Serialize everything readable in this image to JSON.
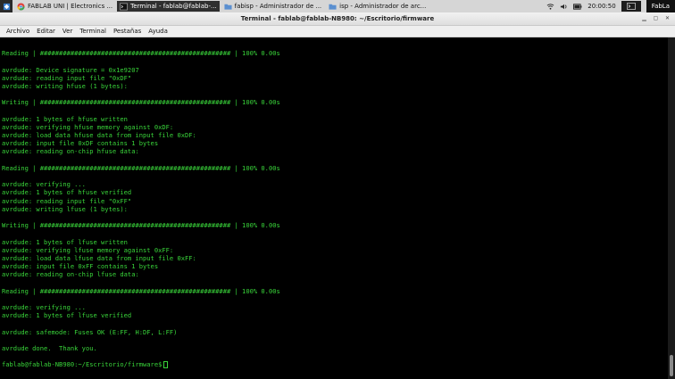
{
  "taskbar": {
    "tasks": [
      {
        "label": "FABLAB UNI | Electronics ...",
        "icon": "chrome-icon"
      },
      {
        "label": "Terminal - fablab@fablab-...",
        "icon": "terminal-icon"
      },
      {
        "label": "fabisp - Administrador de ...",
        "icon": "folder-icon"
      },
      {
        "label": "isp - Administrador de arc...",
        "icon": "folder-icon"
      }
    ],
    "clock": "20:00:50",
    "right_title": "FabLa"
  },
  "window": {
    "title": "Terminal - fablab@fablab-NB980: ~/Escritorio/firmware"
  },
  "menu": {
    "items": [
      "Archivo",
      "Editar",
      "Ver",
      "Terminal",
      "Pestañas",
      "Ayuda"
    ]
  },
  "terminal": {
    "lines": [
      "",
      "Reading | ################################################## | 100% 0.00s",
      "",
      "avrdude: Device signature = 0x1e9207",
      "avrdude: reading input file \"0xDF\"",
      "avrdude: writing hfuse (1 bytes):",
      "",
      "Writing | ################################################## | 100% 0.00s",
      "",
      "avrdude: 1 bytes of hfuse written",
      "avrdude: verifying hfuse memory against 0xDF:",
      "avrdude: load data hfuse data from input file 0xDF:",
      "avrdude: input file 0xDF contains 1 bytes",
      "avrdude: reading on-chip hfuse data:",
      "",
      "Reading | ################################################## | 100% 0.00s",
      "",
      "avrdude: verifying ...",
      "avrdude: 1 bytes of hfuse verified",
      "avrdude: reading input file \"0xFF\"",
      "avrdude: writing lfuse (1 bytes):",
      "",
      "Writing | ################################################## | 100% 0.00s",
      "",
      "avrdude: 1 bytes of lfuse written",
      "avrdude: verifying lfuse memory against 0xFF:",
      "avrdude: load data lfuse data from input file 0xFF:",
      "avrdude: input file 0xFF contains 1 bytes",
      "avrdude: reading on-chip lfuse data:",
      "",
      "Reading | ################################################## | 100% 0.00s",
      "",
      "avrdude: verifying ...",
      "avrdude: 1 bytes of lfuse verified",
      "",
      "avrdude: safemode: Fuses OK (E:FF, H:DF, L:FF)",
      "",
      "avrdude done.  Thank you.",
      ""
    ],
    "prompt": "fablab@fablab-NB980:~/Escritorio/firmware$"
  },
  "colors": {
    "terminal_fg": "#39d53a",
    "terminal_bg": "#000000"
  }
}
